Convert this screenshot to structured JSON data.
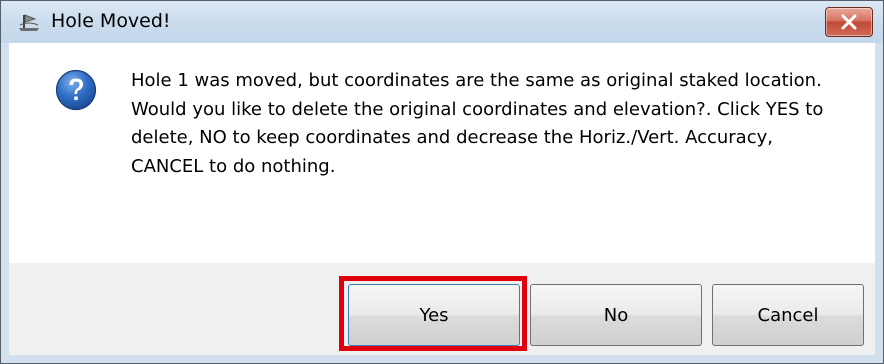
{
  "dialog": {
    "title": "Hole Moved!",
    "icon": "question-icon",
    "message": "Hole 1 was moved, but coordinates are the same as original staked location.  Would you like to delete the original coordinates and elevation?.  Click YES to delete, NO to keep coordinates and decrease the Horiz./Vert. Accuracy, CANCEL to do nothing.",
    "buttons": {
      "yes": "Yes",
      "no": "No",
      "cancel": "Cancel"
    },
    "highlight_color": "#e0000e",
    "close_button_color": "#c24a37"
  }
}
